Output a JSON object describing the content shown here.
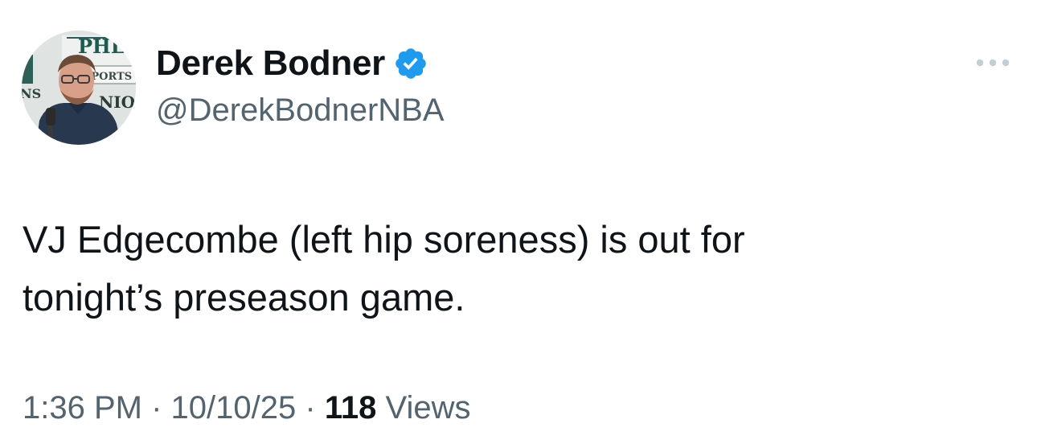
{
  "tweet": {
    "author": {
      "display_name": "Derek Bodner",
      "handle": "@DerekBodnerNBA",
      "verified": true,
      "avatar_backdrop_text": {
        "line1": "PHL",
        "line2": "SPORTS",
        "line3": "NIO",
        "left": "NS"
      }
    },
    "text": "VJ Edgecombe (left hip soreness) is out for\ntonight’s preseason game.",
    "time": "1:36 PM",
    "separator": "·",
    "date": "10/10/25",
    "views_count": "118",
    "views_label": "Views"
  },
  "icons": {
    "verified": "verified-badge-icon",
    "more": "more-horizontal-icon"
  },
  "colors": {
    "text_primary": "#0f1419",
    "text_secondary": "#536471",
    "verified_blue": "#1d9bf0",
    "icon_gray": "#c4cdd4"
  }
}
